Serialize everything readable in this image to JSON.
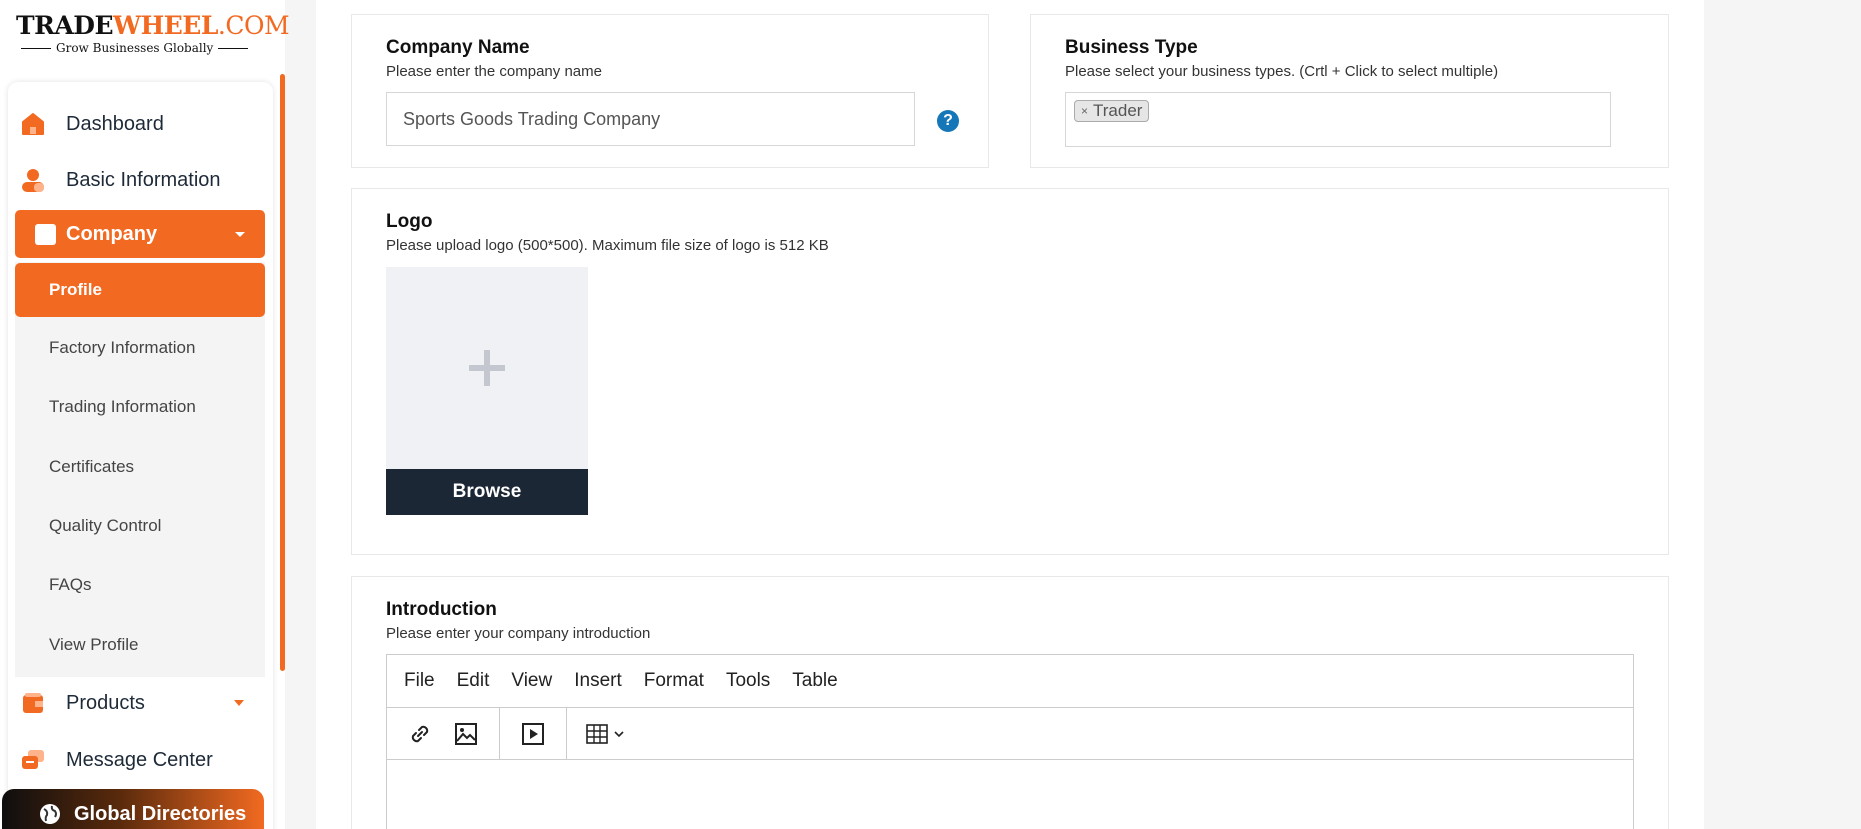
{
  "logo": {
    "trade": "TRADE",
    "wheel": "WHEEL",
    "com": ".COM",
    "tagline": "Grow Businesses Globally"
  },
  "sidebar": {
    "items": [
      {
        "label": "Dashboard",
        "icon": "home-icon"
      },
      {
        "label": "Basic Information",
        "icon": "user-icon"
      },
      {
        "label": "Company",
        "icon": "company-icon"
      },
      {
        "label": "Products",
        "icon": "products-icon"
      },
      {
        "label": "Message Center",
        "icon": "message-icon"
      },
      {
        "label": "Global Directories",
        "icon": "globe-icon"
      }
    ],
    "company_submenu": [
      "Profile",
      "Factory Information",
      "Trading Information",
      "Certificates",
      "Quality Control",
      "FAQs",
      "View Profile"
    ],
    "active_submenu": "Profile"
  },
  "company_name": {
    "title": "Company Name",
    "hint": "Please enter the company name",
    "value": "Sports Goods Trading Company",
    "help": "?"
  },
  "business_type": {
    "title": "Business Type",
    "hint": "Please select your business types. (Crtl + Click to select multiple)",
    "selected": [
      "Trader"
    ],
    "remove_symbol": "×"
  },
  "logo_upload": {
    "title": "Logo",
    "hint": "Please upload logo (500*500). Maximum file size of logo is 512 KB",
    "browse_label": "Browse"
  },
  "introduction": {
    "title": "Introduction",
    "hint": "Please enter your company introduction",
    "menu": [
      "File",
      "Edit",
      "View",
      "Insert",
      "Format",
      "Tools",
      "Table"
    ],
    "toolbar": [
      "link-icon",
      "image-icon",
      "media-icon",
      "table-icon"
    ]
  },
  "colors": {
    "brand_orange": "#f26a21",
    "dark_navy": "#1b2735",
    "help_blue": "#1677b8"
  }
}
